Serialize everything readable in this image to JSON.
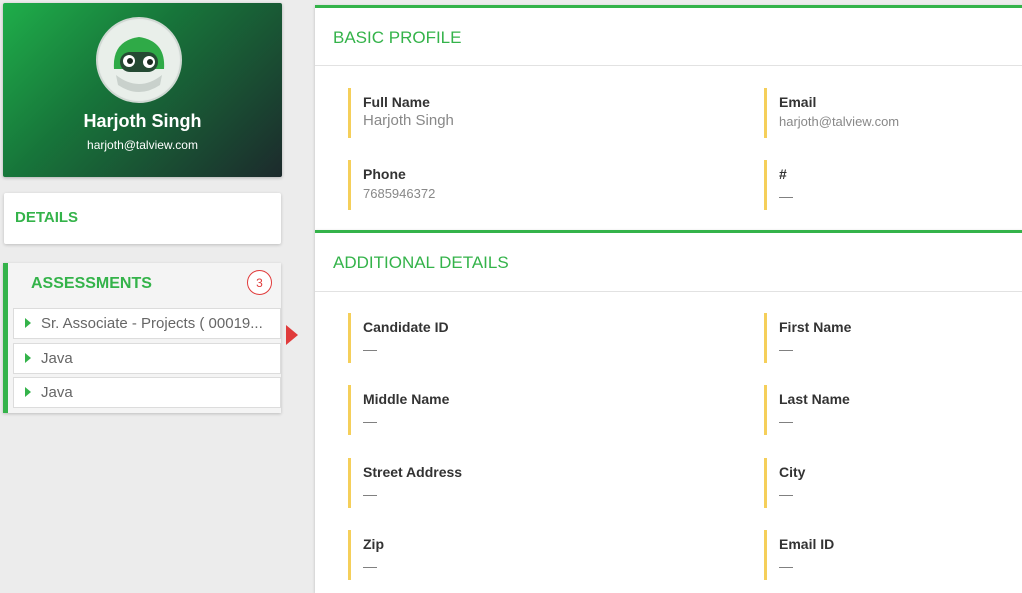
{
  "profile": {
    "name": "Harjoth Singh",
    "email": "harjoth@talview.com"
  },
  "sidebar": {
    "details_label": "DETAILS",
    "assessments_label": "ASSESSMENTS",
    "assessments_count": "3",
    "assessments": [
      {
        "label": "Sr. Associate - Projects ( 00019..."
      },
      {
        "label": "Java"
      },
      {
        "label": "Java"
      }
    ]
  },
  "basic_profile": {
    "title": "BASIC PROFILE",
    "fields": [
      {
        "label": "Full Name",
        "value": "Harjoth Singh"
      },
      {
        "label": "Email",
        "value": "harjoth@talview.com"
      },
      {
        "label": "Phone",
        "value": "7685946372"
      },
      {
        "label": "#",
        "value": "—"
      }
    ]
  },
  "additional_details": {
    "title": "ADDITIONAL DETAILS",
    "fields": [
      {
        "label": "Candidate ID",
        "value": "—"
      },
      {
        "label": "First Name",
        "value": "—"
      },
      {
        "label": "Middle Name",
        "value": "—"
      },
      {
        "label": "Last Name",
        "value": "—"
      },
      {
        "label": "Street Address",
        "value": "—"
      },
      {
        "label": "City",
        "value": "—"
      },
      {
        "label": "Zip",
        "value": "—"
      },
      {
        "label": "Email ID",
        "value": "—"
      }
    ]
  },
  "colors": {
    "accent": "#34b34a",
    "alert": "#e03b3b",
    "field_marker": "#f5cf5a"
  },
  "icons": {
    "avatar": "robot-avatar-icon",
    "item_caret": "caret-right-icon",
    "selected_marker": "triangle-right-icon"
  }
}
